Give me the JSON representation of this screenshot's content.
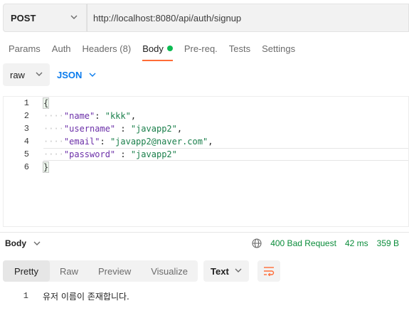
{
  "request": {
    "method": "POST",
    "url": "http://localhost:8080/api/auth/signup"
  },
  "tabs": [
    {
      "label": "Params"
    },
    {
      "label": "Auth"
    },
    {
      "label": "Headers (8)"
    },
    {
      "label": "Body"
    },
    {
      "label": "Pre-req."
    },
    {
      "label": "Tests"
    },
    {
      "label": "Settings"
    }
  ],
  "active_tab": "Body",
  "body_options": {
    "mode": "raw",
    "format": "JSON"
  },
  "editor": {
    "line_numbers": [
      "1",
      "2",
      "3",
      "4",
      "5",
      "6"
    ],
    "lines": {
      "l1": "{",
      "l2_key": "\"name\"",
      "l2_sep": ": ",
      "l2_val": "\"kkk\"",
      "l2_end": ",",
      "l3_key": "\"username\"",
      "l3_sep": " : ",
      "l3_val": "\"javapp2\"",
      "l3_end": ",",
      "l4_key": "\"email\"",
      "l4_sep": ": ",
      "l4_val": "\"javapp2@naver.com\"",
      "l4_end": ",",
      "l5_key": "\"password\"",
      "l5_sep": " : ",
      "l5_val": "\"javapp2\"",
      "l6": "}"
    }
  },
  "response": {
    "title": "Body",
    "status": "400 Bad Request",
    "time": "42 ms",
    "size": "359 B",
    "views": [
      "Pretty",
      "Raw",
      "Preview",
      "Visualize"
    ],
    "active_view": "Pretty",
    "format": "Text",
    "body_line_number": "1",
    "body_text": "유저 이름이 존재합니다."
  },
  "colors": {
    "accent": "#ff6c37",
    "status_ok_green": "#0a8c3a",
    "json_blue": "#097bed",
    "body_dot": "#0cbb52"
  }
}
